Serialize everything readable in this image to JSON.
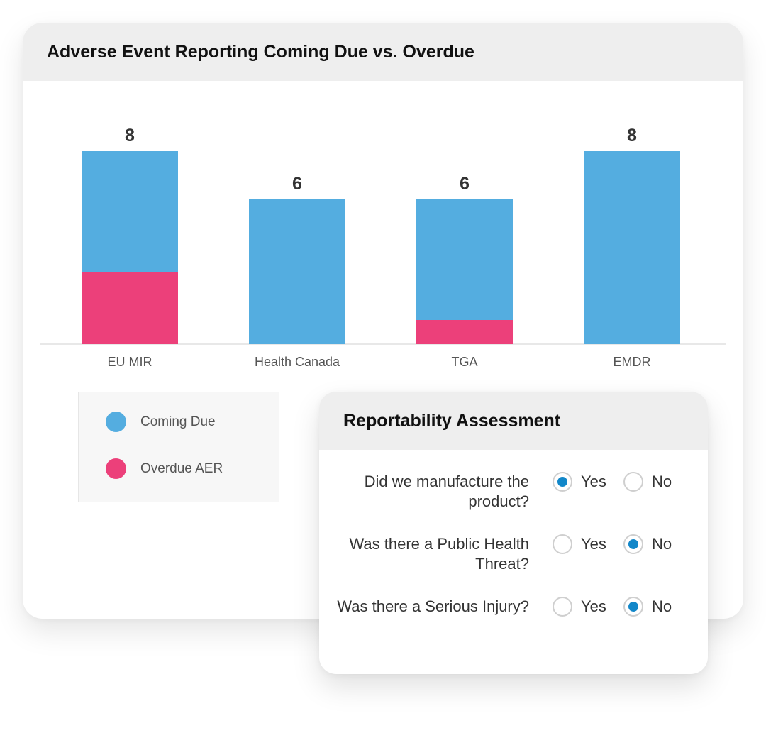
{
  "chart_card": {
    "title": "Adverse Event Reporting Coming Due vs. Overdue"
  },
  "chart_data": {
    "type": "bar",
    "stacked": true,
    "title": "Adverse Event Reporting Coming Due vs. Overdue",
    "xlabel": "",
    "ylabel": "",
    "categories": [
      "EU MIR",
      "Health Canada",
      "TGA",
      "EMDR"
    ],
    "series": [
      {
        "name": "Coming Due",
        "color": "#54ade0",
        "values": [
          5,
          6,
          5,
          8
        ]
      },
      {
        "name": "Overdue AER",
        "color": "#ec407a",
        "values": [
          3,
          0,
          1,
          0
        ]
      }
    ],
    "totals": [
      8,
      6,
      6,
      8
    ],
    "total_labels": [
      "8",
      "6",
      "6",
      "8"
    ],
    "ylim": [
      0,
      8
    ],
    "grid": false,
    "legend_position": "bottom-left"
  },
  "legend": {
    "items": [
      {
        "label": "Coming Due",
        "color": "#54ade0"
      },
      {
        "label": "Overdue AER",
        "color": "#ec407a"
      }
    ]
  },
  "form_card": {
    "title": "Reportability Assessment",
    "accent_color": "#1287c9",
    "questions": [
      {
        "text": "Did we manufacture the product?",
        "options": [
          "Yes",
          "No"
        ],
        "selected": "Yes"
      },
      {
        "text": "Was there a Public Health Threat?",
        "options": [
          "Yes",
          "No"
        ],
        "selected": "No"
      },
      {
        "text": "Was there a Serious Injury?",
        "options": [
          "Yes",
          "No"
        ],
        "selected": "No"
      }
    ]
  }
}
